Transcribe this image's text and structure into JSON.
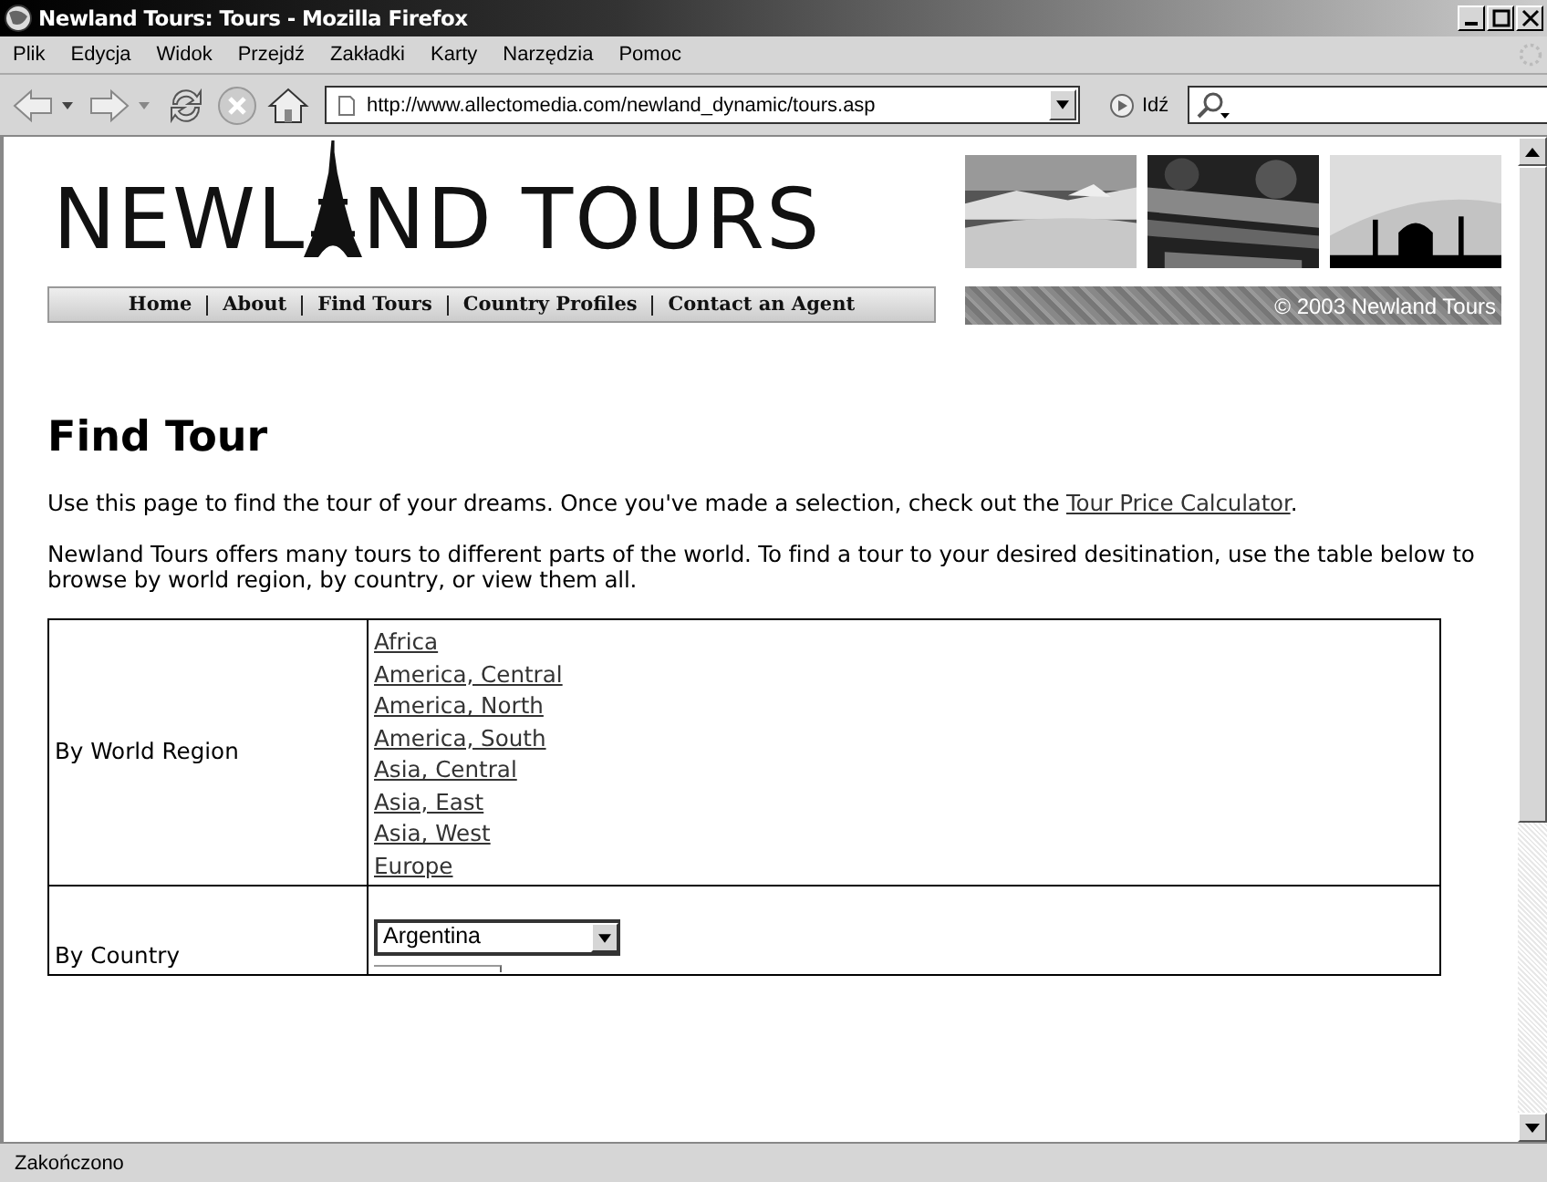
{
  "window": {
    "title": "Newland Tours: Tours - Mozilla Firefox"
  },
  "menu": [
    "Plik",
    "Edycja",
    "Widok",
    "Przejdź",
    "Zakładki",
    "Karty",
    "Narzędzia",
    "Pomoc"
  ],
  "toolbar": {
    "address": "http://www.allectomedia.com/newland_dynamic/tours.asp",
    "go_label": "Idź"
  },
  "banner": {
    "logo_before": "NEWL",
    "logo_after": "ND TOURS",
    "nav": [
      "Home",
      "About",
      "Find Tours",
      "Country Profiles",
      "Contact an Agent"
    ],
    "copyright": "© 2003 Newland Tours"
  },
  "heading": "Find Tour",
  "intro": {
    "text": "Use this page to find the tour of your dreams. Once you've made a selection, check out the ",
    "link": "Tour Price Calculator",
    "after": "."
  },
  "paragraph": "Newland Tours offers many tours to different parts of the world. To find a tour to your desired desitination, use the table below to browse by world region, by country, or view them all.",
  "table": {
    "rows": [
      {
        "kind": "links",
        "label": "By World Region",
        "links": [
          "Africa",
          "America, Central",
          "America, North",
          "America, South",
          "Asia, Central",
          "Asia, East",
          "Asia, West",
          "Europe"
        ]
      },
      {
        "kind": "select",
        "label": "By Country",
        "value": "Argentina"
      }
    ]
  },
  "status_bar": "Zakończono"
}
